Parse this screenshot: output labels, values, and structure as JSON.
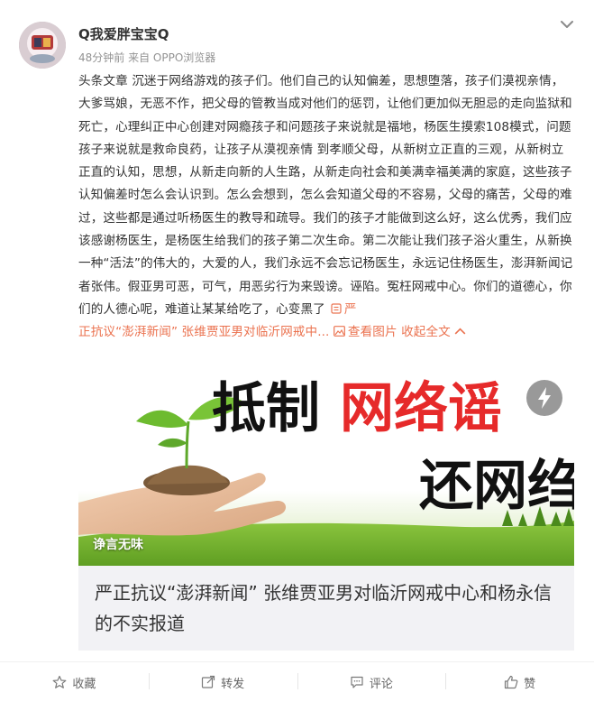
{
  "post": {
    "user": {
      "name": "Q我爱胖宝宝Q",
      "avatar_icon": "avatar-icon"
    },
    "meta": {
      "time": "48分钟前",
      "source": "来自 OPPO浏览器"
    },
    "text_main": "头条文章 沉迷于网络游戏的孩子们。他们自己的认知偏差，思想堕落，孩子们漠视亲情，大爹骂娘，无恶不作，把父母的管教当成对他们的惩罚，让他们更加似无胆忌的走向监狱和死亡，心理纠正中心创建对网瘾孩子和问题孩子来说就是福地，杨医生摸索108模式，问题孩子来说就是救命良药，让孩子从漠视亲情 到孝顺父母，从新树立正直的三观，从新树立正直的认知，思想，从新走向新的人生路，从新走向社会和美满幸福美满的家庭，这些孩子认知偏差时怎么会认识到。怎么会想到，怎么会知道父母的不容易，父母的痛苦，父母的难过，这些都是通过听杨医生的教导和疏导。我们的孩子才能做到这么好，这么优秀，我们应该感谢杨医生，是杨医生给我们的孩子第二次生命。第二次能让我们孩子浴火重生，从新换一种“活法”的伟大的，大爱的人，我们永远不会忘记杨医生，永远记住杨医生，澎湃新闻记者张伟。假亚男可恶，可气，用恶劣行为来毁谤。诬陷。冤枉网戒中心。你们的道德心，你们的人德心呢，难道让某某给吃了，心变黑了",
    "article_link_part1": "严",
    "article_link_part2": "正抗议“澎湃新闻” 张维贾亚男对临沂网戒中...",
    "view_image": "查看图片",
    "collapse": "收起全文",
    "card": {
      "title": "严正抗议“澎湃新闻” 张维贾亚男对临沂网戒中心和杨永信的不实报道",
      "image_text_1": "抵制",
      "image_text_2": "网络谣",
      "image_text_3": "还网绉",
      "brand": "诤言无味"
    },
    "actions": {
      "favorite": "收藏",
      "repost": "转发",
      "comment": "评论",
      "like": "赞"
    }
  }
}
